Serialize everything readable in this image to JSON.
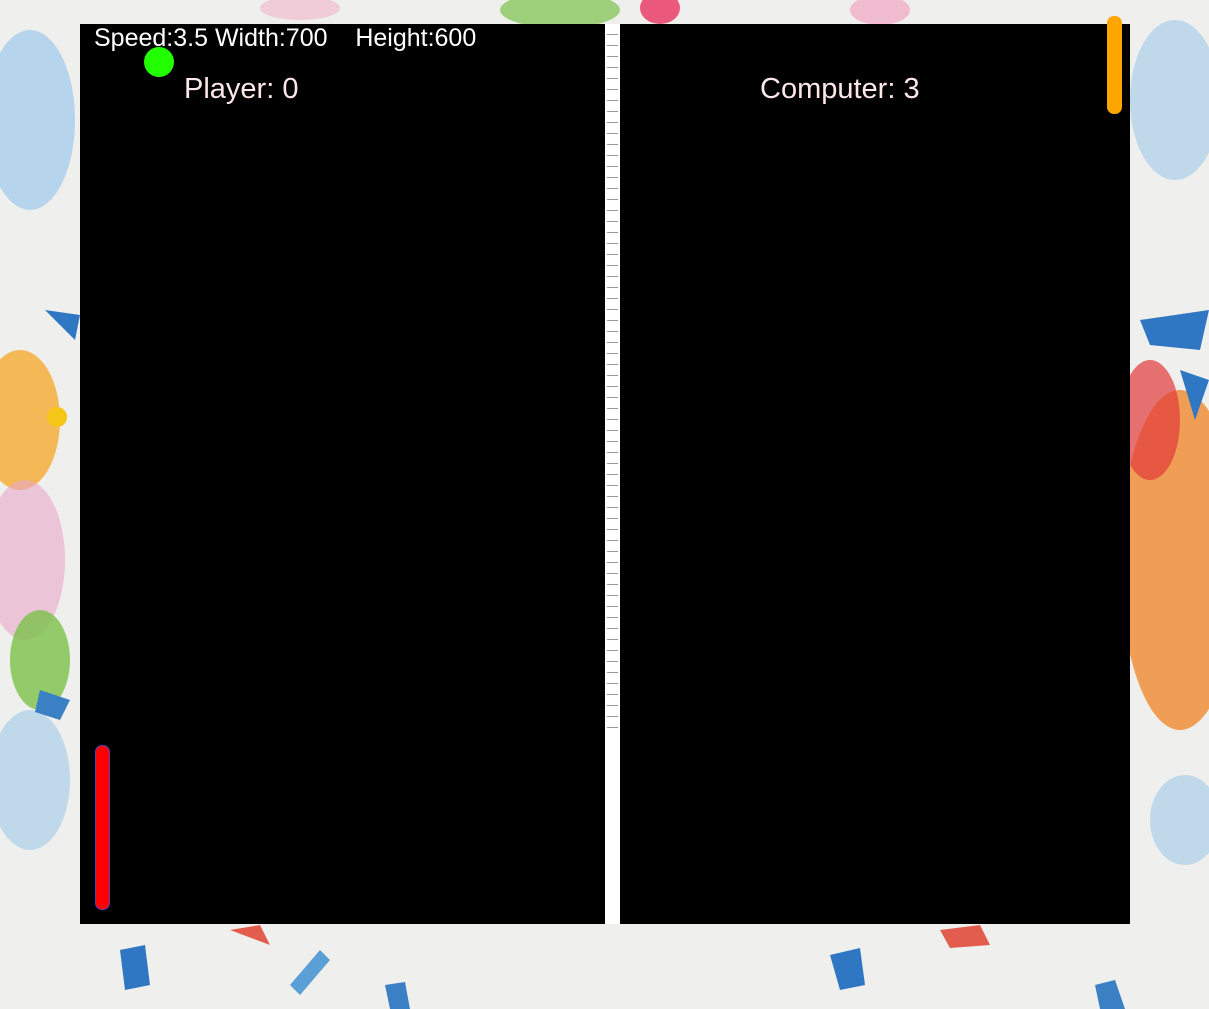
{
  "hud": {
    "speed_text": "Speed:3.5",
    "width_text": "Width:700",
    "height_text": "Height:600"
  },
  "scores": {
    "player_label": "Player: 0",
    "computer_label": "Computer: 3",
    "player": 0,
    "computer": 3
  },
  "game": {
    "speed": 3.5,
    "width": 700,
    "height": 600
  },
  "colors": {
    "board": "#000000",
    "ball": "#22ff00",
    "player_paddle": "#ff0000",
    "computer_paddle": "#ffa500",
    "net": "#ffffff"
  },
  "icons": {
    "ball": "green-circle",
    "player_paddle": "red-bar",
    "computer_paddle": "orange-bar"
  }
}
